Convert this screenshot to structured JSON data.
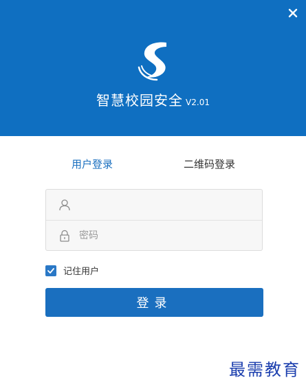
{
  "header": {
    "title": "智慧校园安全",
    "version": "V2.01",
    "logo_icon": "s-logo-icon",
    "close_icon": "close-icon",
    "background_color": "#0f6fc1"
  },
  "tabs": {
    "user_login": "用户登录",
    "qr_login": "二维码登录",
    "active": "user_login",
    "active_color": "#1a6fbf"
  },
  "form": {
    "username": {
      "value": "",
      "placeholder": "",
      "icon": "user-icon"
    },
    "password": {
      "value": "",
      "placeholder": "密码",
      "icon": "lock-icon"
    },
    "remember": {
      "label": "记住用户",
      "checked": true
    }
  },
  "login_button": {
    "label": "登录",
    "color": "#1a6fbf"
  },
  "watermark": {
    "text": "最需教育"
  }
}
